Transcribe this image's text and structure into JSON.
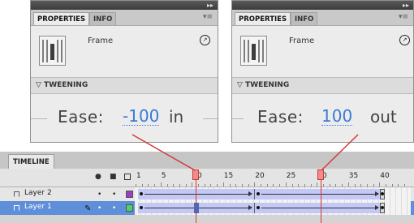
{
  "left_panel": {
    "tabs": [
      "PROPERTIES",
      "INFO"
    ],
    "topbar_glyph": "▸▸",
    "menu_glyph": "▾≡",
    "frame_label": "Frame",
    "section_title": "TWEENING",
    "ease_label": "Ease:",
    "ease_value": "-100",
    "ease_direction": "in"
  },
  "right_panel": {
    "tabs": [
      "PROPERTIES",
      "INFO"
    ],
    "topbar_glyph": "▸▸",
    "menu_glyph": "▾≡",
    "frame_label": "Frame",
    "section_title": "TWEENING",
    "ease_label": "Ease:",
    "ease_value": "100",
    "ease_direction": "out"
  },
  "collapse_glyph": "▽",
  "timeline": {
    "tab_label": "TIMELINE",
    "ruler": [
      "1",
      "5",
      "10",
      "15",
      "20",
      "25",
      "30",
      "35",
      "40"
    ],
    "header_icons": {
      "eye": "👁",
      "lock": "🔒"
    },
    "layers": [
      {
        "name": "Layer 2",
        "color": "#9a3fc0",
        "selected": false
      },
      {
        "name": "Layer 1",
        "color": "#4fd16a",
        "selected": true
      }
    ],
    "pencil_glyph": "✎",
    "dot_glyph": "•"
  },
  "colors": {
    "ease_value": "#3a7bd5",
    "tween_fill": "#c4c8f5",
    "playhead": "#d23a3a",
    "selected_row": "#5f8fd9"
  }
}
